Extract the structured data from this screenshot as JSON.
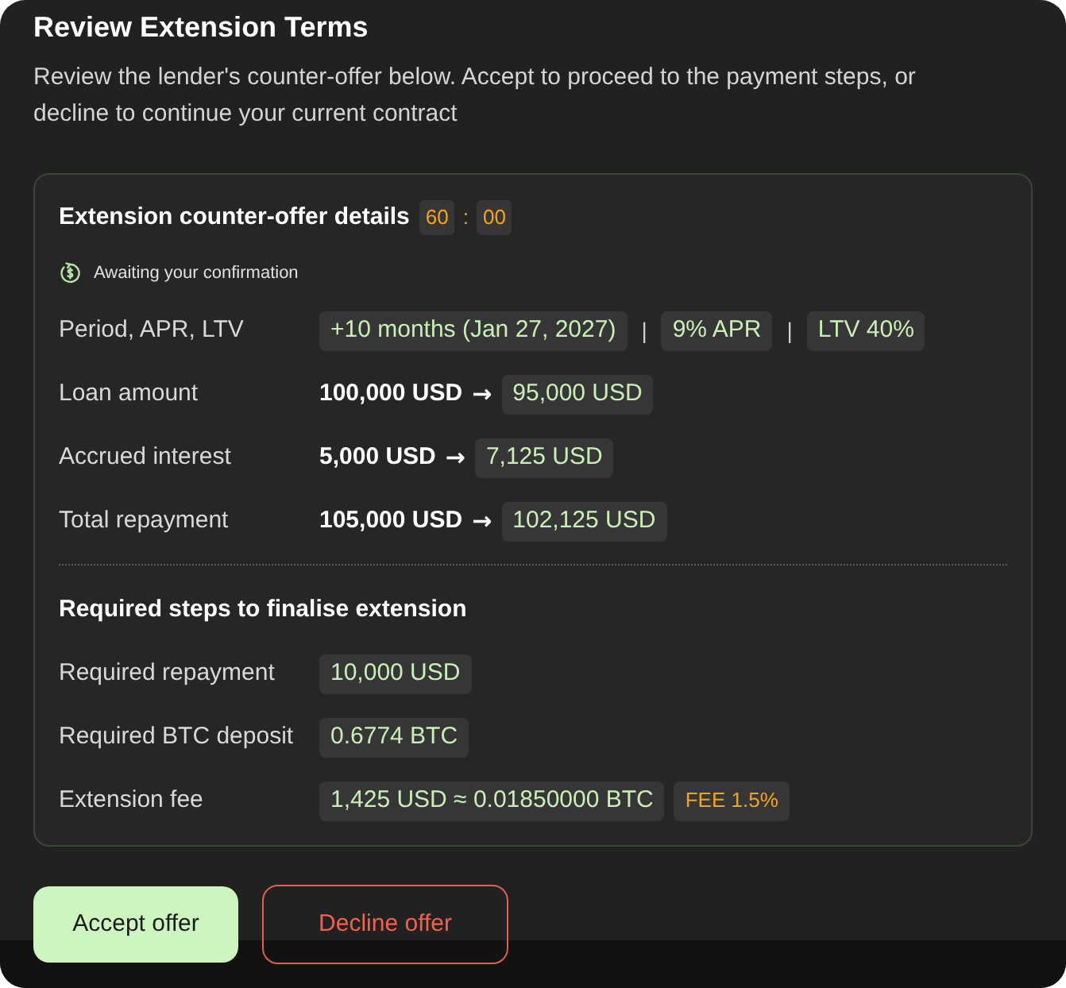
{
  "dialog": {
    "title": "Review Extension Terms",
    "description": "Review the lender's counter-offer below. Accept to proceed to the payment steps, or decline to continue your current contract"
  },
  "offer_card": {
    "title": "Extension counter-offer details",
    "timer": {
      "minutes": "60",
      "separator": ":",
      "seconds": "00"
    },
    "status": "Awaiting your confirmation",
    "rows": [
      {
        "label": "Period, APR, LTV",
        "values": [
          {
            "kind": "chip",
            "text": "+10 months (Jan 27, 2027)"
          },
          {
            "kind": "separator",
            "text": "|"
          },
          {
            "kind": "chip",
            "text": "9% APR"
          },
          {
            "kind": "separator",
            "text": "|"
          },
          {
            "kind": "chip",
            "text": "LTV 40%"
          }
        ]
      },
      {
        "label": "Loan amount",
        "values": [
          {
            "kind": "old",
            "text": "100,000 USD"
          },
          {
            "kind": "arrow",
            "text": "→"
          },
          {
            "kind": "chip",
            "text": "95,000 USD"
          }
        ]
      },
      {
        "label": "Accrued interest",
        "values": [
          {
            "kind": "old",
            "text": "5,000 USD"
          },
          {
            "kind": "arrow",
            "text": "→"
          },
          {
            "kind": "chip",
            "text": "7,125 USD"
          }
        ]
      },
      {
        "label": "Total repayment",
        "values": [
          {
            "kind": "old",
            "text": "105,000 USD"
          },
          {
            "kind": "arrow",
            "text": "→"
          },
          {
            "kind": "chip",
            "text": "102,125 USD"
          }
        ]
      }
    ],
    "steps": {
      "title": "Required steps to finalise extension",
      "rows": [
        {
          "label": "Required repayment",
          "values": [
            {
              "kind": "chip",
              "text": "10,000 USD"
            }
          ]
        },
        {
          "label": "Required BTC deposit",
          "values": [
            {
              "kind": "chip",
              "text": "0.6774 BTC"
            }
          ]
        },
        {
          "label": "Extension fee",
          "values": [
            {
              "kind": "chip",
              "text": "1,425 USD ≈ 0.01850000 BTC"
            },
            {
              "kind": "fee",
              "text": "FEE 1.5%"
            }
          ]
        }
      ]
    }
  },
  "buttons": [
    {
      "label": "Accept offer",
      "kind": "primary"
    },
    {
      "label": "Decline offer",
      "kind": "danger"
    }
  ]
}
